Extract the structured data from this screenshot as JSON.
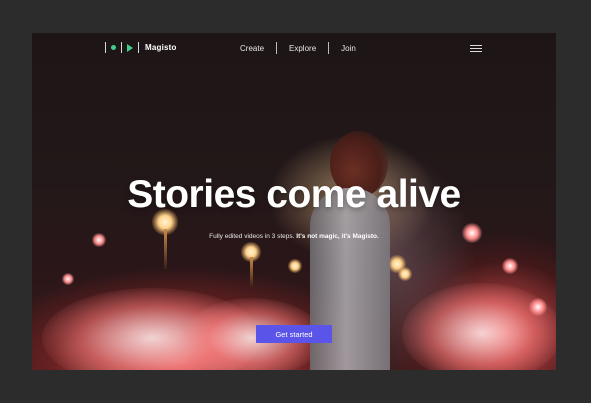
{
  "brand": {
    "name": "Magisto"
  },
  "nav": {
    "items": [
      {
        "label": "Create"
      },
      {
        "label": "Explore"
      },
      {
        "label": "Join"
      }
    ]
  },
  "hero": {
    "headline": "Stories come alive",
    "subtitle_plain": "Fully edited videos in 3 steps.",
    "subtitle_bold": "It's not magic, it's Magisto.",
    "cta_label": "Get started"
  },
  "icons": {
    "logo_mark": "dot-play-logo-icon",
    "menu": "hamburger-menu-icon"
  },
  "colors": {
    "cta": "#5b54e8",
    "logo_accent": "#3ecf8e",
    "page_bg": "#2c2c2c"
  }
}
